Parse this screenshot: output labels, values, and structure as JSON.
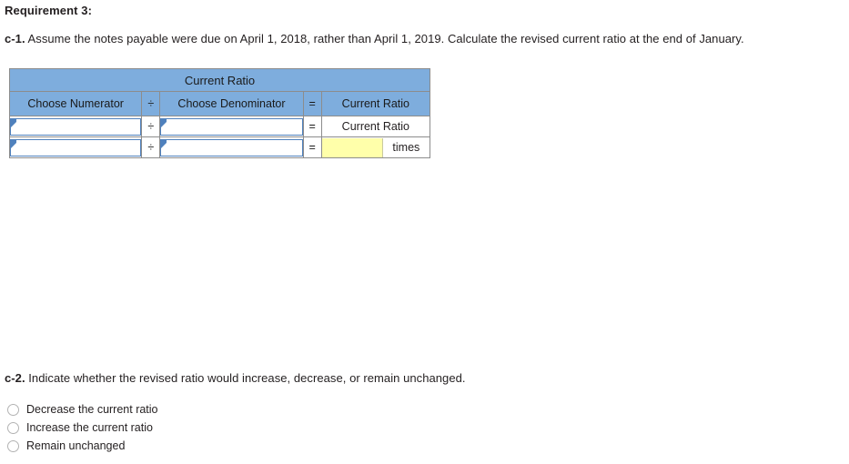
{
  "requirement": {
    "title": "Requirement 3:"
  },
  "part_c1": {
    "lead": "c-1.",
    "text": " Assume the notes payable were due on April 1, 2018, rather than April 1, 2019. Calculate the revised current ratio at the end of January."
  },
  "ratio_table": {
    "title": "Current Ratio",
    "columns": {
      "numerator": "Choose Numerator",
      "divide_op": "÷",
      "denominator": "Choose Denominator",
      "equals_op": "=",
      "result": "Current Ratio"
    },
    "rows": [
      {
        "numerator_value": "",
        "divide_op": "÷",
        "denominator_value": "",
        "equals_op": "=",
        "result_label": "Current Ratio"
      },
      {
        "numerator_value": "",
        "divide_op": "÷",
        "denominator_value": "",
        "equals_op": "=",
        "result_value": "",
        "result_unit": "times"
      }
    ]
  },
  "part_c2": {
    "lead": "c-2.",
    "text": " Indicate whether the revised ratio would increase, decrease, or remain unchanged.",
    "options": [
      {
        "label": "Decrease the current ratio",
        "selected": false
      },
      {
        "label": "Increase the current ratio",
        "selected": false
      },
      {
        "label": "Remain unchanged",
        "selected": false
      }
    ]
  },
  "colors": {
    "header_blue": "#7EADDD",
    "field_border_blue": "#4F81BD",
    "input_yellow": "#FFFFAA",
    "table_border_gray": "#8C8C8C",
    "radio_border_gray": "#B3B3B3"
  }
}
